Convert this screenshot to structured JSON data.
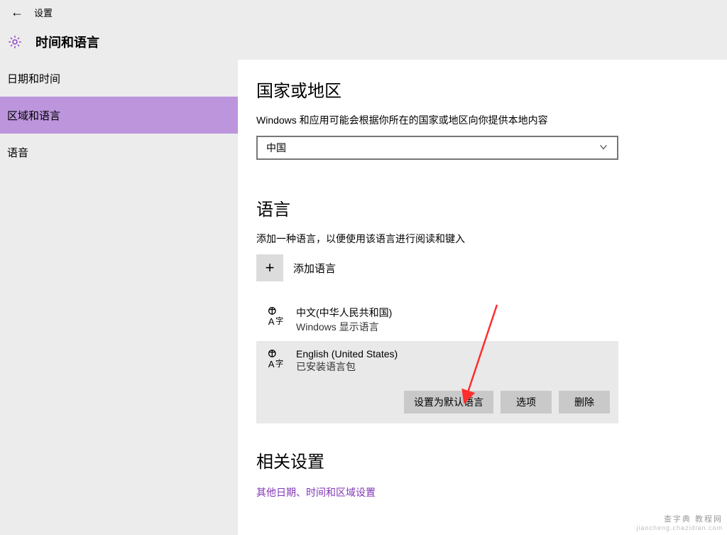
{
  "header": {
    "app_title": "设置",
    "category": "时间和语言"
  },
  "sidebar": {
    "items": [
      {
        "label": "日期和时间",
        "selected": false
      },
      {
        "label": "区域和语言",
        "selected": true
      },
      {
        "label": "语音",
        "selected": false
      }
    ]
  },
  "region": {
    "title": "国家或地区",
    "desc": "Windows 和应用可能会根据你所在的国家或地区向你提供本地内容",
    "selected": "中国"
  },
  "language": {
    "title": "语言",
    "desc": "添加一种语言，以便使用该语言进行阅读和键入",
    "add_label": "添加语言",
    "items": [
      {
        "name": "中文(中华人民共和国)",
        "sub": "Windows 显示语言",
        "selected": false
      },
      {
        "name": "English (United States)",
        "sub": "已安装语言包",
        "selected": true
      }
    ],
    "actions": {
      "set_default": "设置为默认语言",
      "options": "选项",
      "remove": "删除"
    }
  },
  "related": {
    "title": "相关设置",
    "link": "其他日期、时间和区域设置"
  },
  "watermark": {
    "line1": "查字典 教程网",
    "line2": "jiaocheng.chazidian.com"
  }
}
